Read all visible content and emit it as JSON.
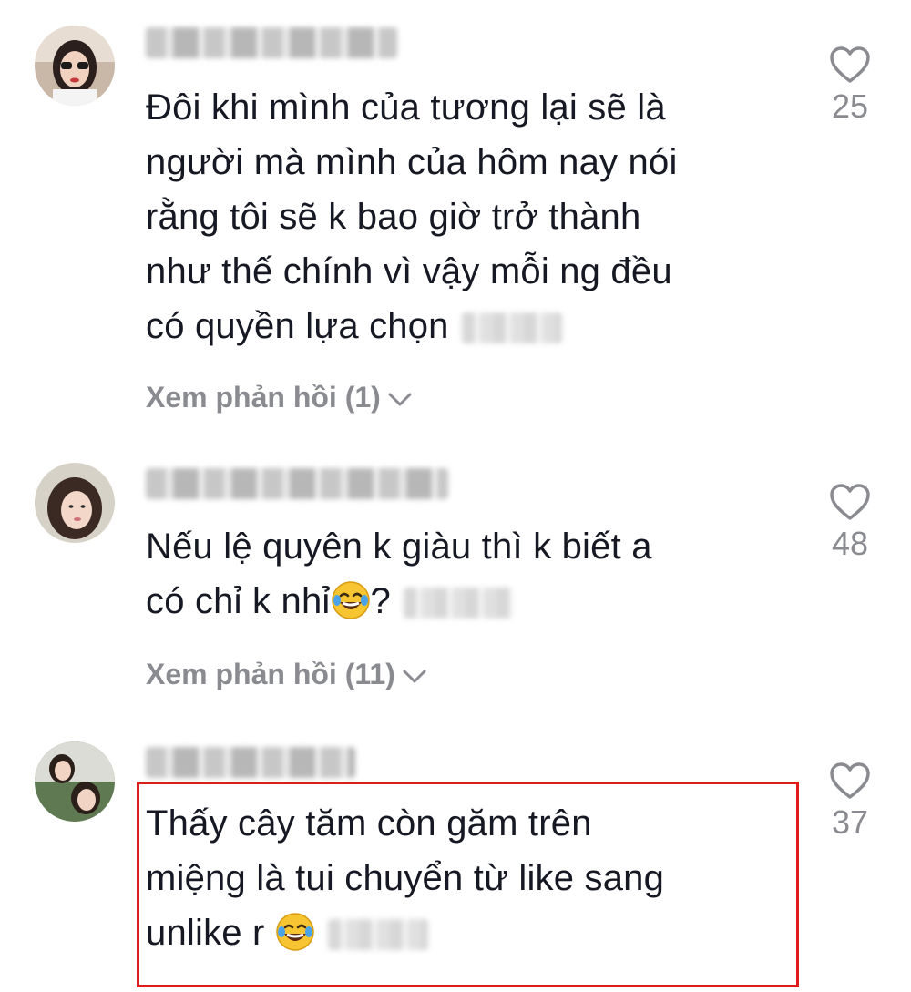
{
  "comments": [
    {
      "text_lines": [
        "Đôi khi mình của tương lại sẽ là",
        "người mà mình của hôm nay nói",
        "rằng tôi sẽ k bao giờ trở thành",
        "như thế chính vì vậy mỗi ng đều",
        "có quyền lựa chọn"
      ],
      "replies_label": "Xem phản hồi (1)",
      "likes": "25",
      "avatar_icon": "avatar-photo",
      "username_blurred": true
    },
    {
      "text_lines": [
        "Nếu lệ quyên k giàu thì k biết a",
        "có chỉ k nhỉ",
        "?"
      ],
      "replies_label": "Xem phản hồi (11)",
      "likes": "48",
      "avatar_icon": "avatar-photo",
      "username_blurred": true
    },
    {
      "text_lines": [
        "Thấy cây tăm còn găm trên",
        "miệng là tui chuyển từ like sang",
        "unlike r"
      ],
      "likes": "37",
      "avatar_icon": "avatar-photo",
      "username_blurred": true,
      "highlighted": true
    }
  ],
  "icons": {
    "like": "heart-outline-icon",
    "expand": "chevron-down-icon",
    "emoji": "face-with-tears-of-joy-icon"
  },
  "colors": {
    "text": "#161823",
    "muted": "#8a8b91",
    "highlight_border": "#e01b1b"
  }
}
